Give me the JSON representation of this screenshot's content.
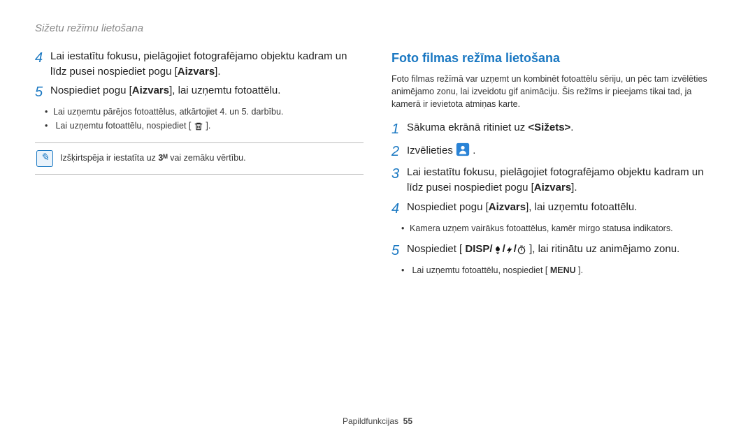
{
  "chapter": "Sižetu režīmu lietošana",
  "left": {
    "steps": [
      {
        "num": "4",
        "parts": [
          "Lai iestatītu fokusu, pielāgojiet fotografējamo objektu kadram un līdz pusei nospiediet pogu [",
          "Aizvars",
          "]."
        ]
      },
      {
        "num": "5",
        "parts": [
          "Nospiediet pogu [",
          "Aizvars",
          "], lai uzņemtu fotoattēlu."
        ],
        "subs": [
          "Lai uzņemtu pārējos fotoattēlus, atkārtojiet 4. un 5. darbību.",
          "Lai uzņemtu fotoattēlu, nospiediet [ 🗑 ]."
        ]
      }
    ],
    "note": {
      "pre": "Izšķirtspēja ir iestatīta uz ",
      "mid_glyph": "3ᴹ",
      "post": " vai zemāku vērtību."
    }
  },
  "right": {
    "heading": "Foto filmas režīma lietošana",
    "intro": "Foto filmas režīmā var uzņemt un kombinēt fotoattēlu sēriju, un pēc tam izvēlēties animējamo zonu, lai izveidotu gif animāciju. Šis režīms ir pieejams tikai tad, ja kamerā ir ievietota atmiņas karte.",
    "steps": [
      {
        "num": "1",
        "parts": [
          "Sākuma ekrānā ritiniet uz ",
          "<Sižets>",
          "."
        ]
      },
      {
        "num": "2",
        "parts": [
          "Izvēlieties ",
          "ICON_PERSON",
          " ."
        ]
      },
      {
        "num": "3",
        "parts": [
          "Lai iestatītu fokusu, pielāgojiet fotografējamo objektu kadram un līdz pusei nospiediet pogu [",
          "Aizvars",
          "]."
        ]
      },
      {
        "num": "4",
        "parts": [
          "Nospiediet pogu [",
          "Aizvars",
          "], lai uzņemtu fotoattēlu."
        ],
        "subs": [
          "Kamera uzņem vairākus fotoattēlus, kamēr mirgo statusa indikators."
        ]
      },
      {
        "num": "5",
        "parts": [
          "Nospiediet [",
          "ICON_DISP_ROW",
          "], lai ritinātu uz animējamo zonu."
        ],
        "subs": [
          "Lai uzņemtu fotoattēlu, nospiediet [ MENU ]."
        ]
      }
    ]
  },
  "footer": {
    "label": "Papildfunkcijas",
    "page": "55"
  },
  "icons": {
    "trash": "trash-icon",
    "person": "person-mode-icon",
    "disp_row": "disp-macro-flash-timer-icons",
    "note": "note-icon"
  }
}
